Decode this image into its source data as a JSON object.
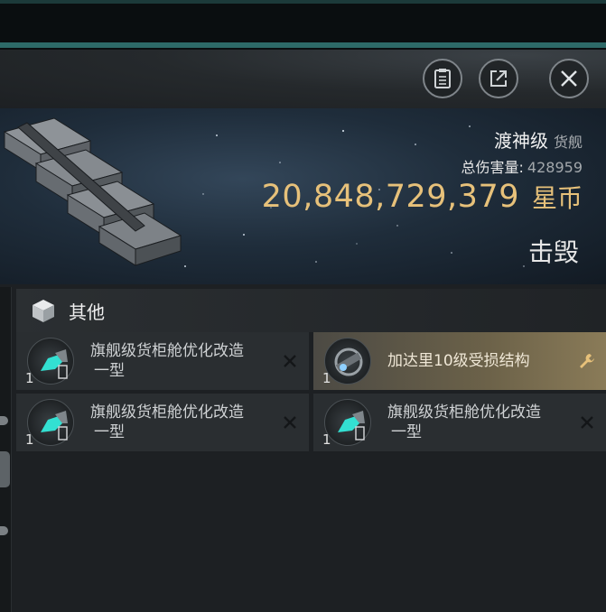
{
  "toolbar": {
    "buttons": [
      "notes-icon",
      "share-icon",
      "close-icon"
    ]
  },
  "ship": {
    "name": "渡神级",
    "class": "货舰",
    "damage_label": "总伤害量:",
    "damage_value": "428959",
    "value": "20,848,729,379",
    "currency": "星币",
    "status": "击毁"
  },
  "section": {
    "title": "其他",
    "icon": "box-icon"
  },
  "items": [
    {
      "qty": "1",
      "name": "旗舰级货柜舱优化改造",
      "sub": "一型",
      "action": "remove-icon"
    },
    {
      "qty": "1",
      "name": "加达里10级受损结构",
      "sub": "",
      "action": "wrench-icon"
    },
    {
      "qty": "1",
      "name": "旗舰级货柜舱优化改造",
      "sub": "一型",
      "action": "remove-icon"
    },
    {
      "qty": "1",
      "name": "旗舰级货柜舱优化改造",
      "sub": "一型",
      "action": "remove-icon"
    }
  ],
  "colors": {
    "accent_gold": "#e7c17a",
    "teal": "#2d6a68",
    "highlight": "#8a7b58"
  }
}
